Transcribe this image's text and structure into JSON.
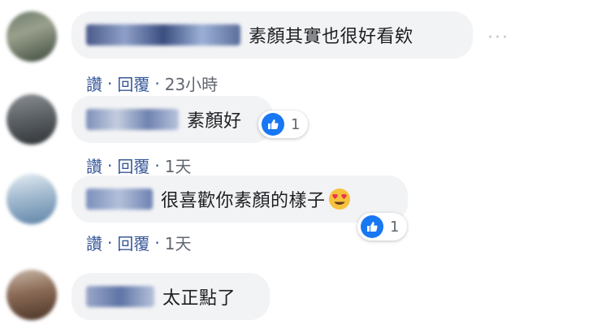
{
  "comments": [
    {
      "text": "素顏其實也很好看欸",
      "actions": {
        "like": "讚",
        "reply": "回覆",
        "sep": "·",
        "time": "23小時"
      },
      "more_icon": "more-horizontal-icon"
    },
    {
      "text": "素顏好",
      "reaction_count": "1",
      "actions": {
        "like": "讚",
        "reply": "回覆",
        "sep": "·",
        "time": "1天"
      }
    },
    {
      "text": "很喜歡你素顏的樣子",
      "emoji": "heart-eyes-emoji",
      "reaction_count": "1",
      "actions": {
        "like": "讚",
        "reply": "回覆",
        "sep": "·",
        "time": "1天"
      }
    },
    {
      "text": "太正點了"
    }
  ],
  "colors": {
    "bubble": "#f2f3f5",
    "link": "#385898",
    "like_blue": "#1877f2"
  }
}
